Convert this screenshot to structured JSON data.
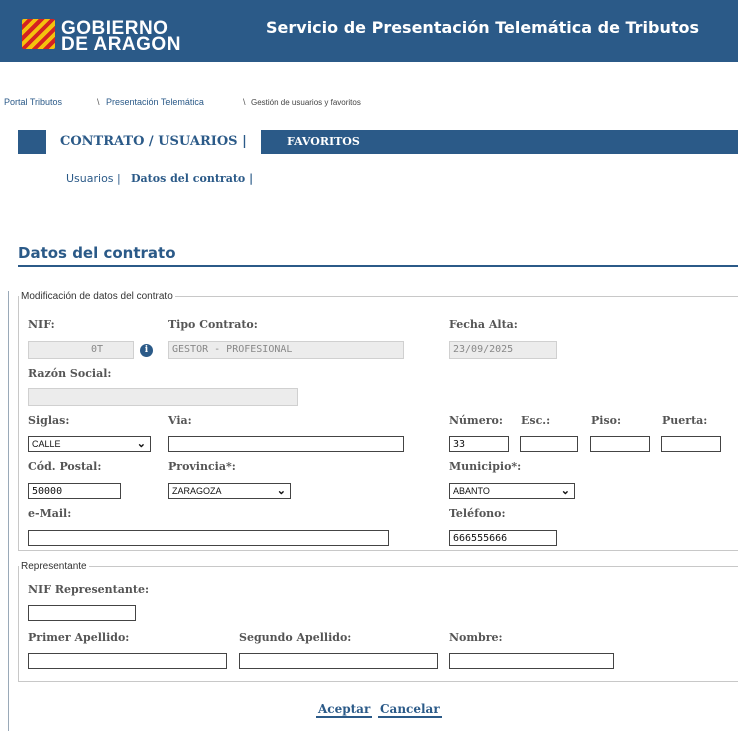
{
  "header": {
    "logo_line1": "GOBIERNO",
    "logo_line2": "DE ARAGON",
    "title": "Servicio de Presentación Telemática de Tributos"
  },
  "breadcrumb": {
    "items": [
      "Portal Tributos",
      "Presentación Telemática",
      "Gestión de usuarios y favoritos"
    ],
    "separator": "\\"
  },
  "tabs": {
    "contrato": "CONTRATO / USUARIOS |",
    "favoritos": "FAVORITOS"
  },
  "subtabs": {
    "usuarios": "Usuarios |",
    "datos": "Datos del contrato |"
  },
  "page_title": "Datos del contrato",
  "contract": {
    "legend": "Modificación de datos del contrato",
    "nif_label": "NIF:",
    "nif_value": "0T",
    "tipo_label": "Tipo Contrato:",
    "tipo_value": "GESTOR - PROFESIONAL",
    "fecha_label": "Fecha Alta:",
    "fecha_value": "23/09/2025",
    "razon_label": "Razón Social:",
    "razon_value": "",
    "siglas_label": "Siglas:",
    "siglas_value": "CALLE",
    "via_label": "Via:",
    "via_value": "",
    "numero_label": "Número:",
    "numero_value": "33",
    "esc_label": "Esc.:",
    "esc_value": "",
    "piso_label": "Piso:",
    "piso_value": "",
    "puerta_label": "Puerta:",
    "puerta_value": "",
    "cp_label": "Cód. Postal:",
    "cp_value": "50000",
    "provincia_label": "Provincia*:",
    "provincia_value": "ZARAGOZA",
    "municipio_label": "Municipio*:",
    "municipio_value": "ABANTO",
    "email_label": "e-Mail:",
    "email_value": "",
    "telefono_label": "Teléfono:",
    "telefono_value": "666555666"
  },
  "representante": {
    "legend": "Representante",
    "nif_label": "NIF Representante:",
    "nif_value": "",
    "apellido1_label": "Primer Apellido:",
    "apellido1_value": "",
    "apellido2_label": "Segundo Apellido:",
    "apellido2_value": "",
    "nombre_label": "Nombre:",
    "nombre_value": ""
  },
  "actions": {
    "accept": "Aceptar",
    "cancel": "Cancelar"
  },
  "colors": {
    "brand_blue": "#2b5a88",
    "header_bg": "#2b5a88"
  },
  "icons": {
    "info": "info-icon",
    "chevron": "chevron-down-icon"
  }
}
